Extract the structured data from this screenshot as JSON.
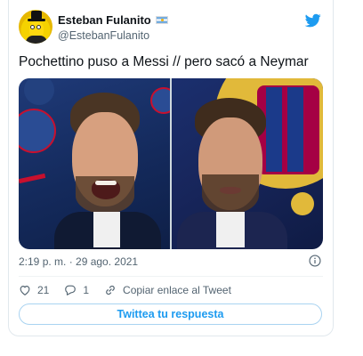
{
  "tweet": {
    "author_name": "Esteban Fulanito",
    "author_handle": "@EstebanFulanito",
    "text": "Pochettino puso a Messi // pero sacó a Neymar",
    "timestamp": "2:19 p. m. · 29 ago. 2021",
    "likes": "21",
    "replies": "1",
    "copy_link_label": "Copiar enlace al Tweet",
    "reply_button_label": "Twittea tu respuesta"
  },
  "icons": {
    "brand": "twitter-bird-icon",
    "verified_flag": "argentina-flag-icon",
    "info": "info-icon",
    "like": "heart-icon",
    "reply": "speech-bubble-icon",
    "link": "link-icon"
  },
  "colors": {
    "accent": "#1d9bf0",
    "muted_text": "#536471",
    "border": "#e1e8ed"
  }
}
